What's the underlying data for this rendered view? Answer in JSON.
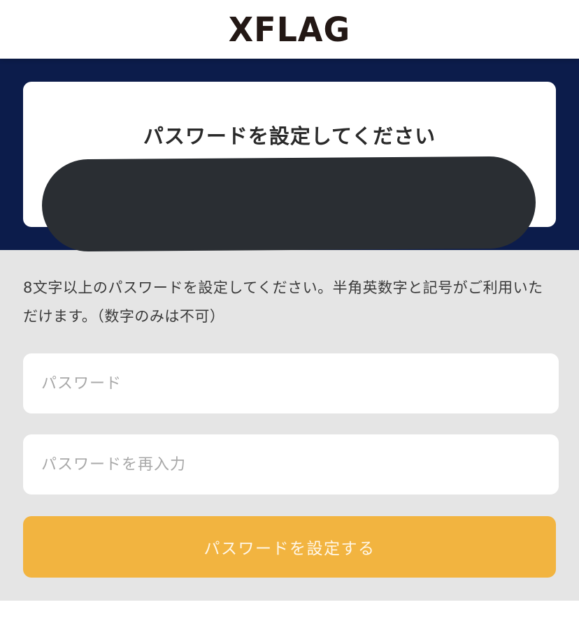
{
  "header": {
    "logo_text": "XFLAG"
  },
  "card": {
    "title": "パスワードを設定してください"
  },
  "form": {
    "description": "8文字以上のパスワードを設定してください。半角英数字と記号がご利用いただけます。（数字のみは不可）",
    "password_placeholder": "パスワード",
    "password_value": "",
    "confirm_placeholder": "パスワードを再入力",
    "confirm_value": "",
    "submit_label": "パスワードを設定する"
  },
  "colors": {
    "navy": "#0c1c4b",
    "accent": "#f2b440",
    "background_gray": "#e5e5e5"
  }
}
